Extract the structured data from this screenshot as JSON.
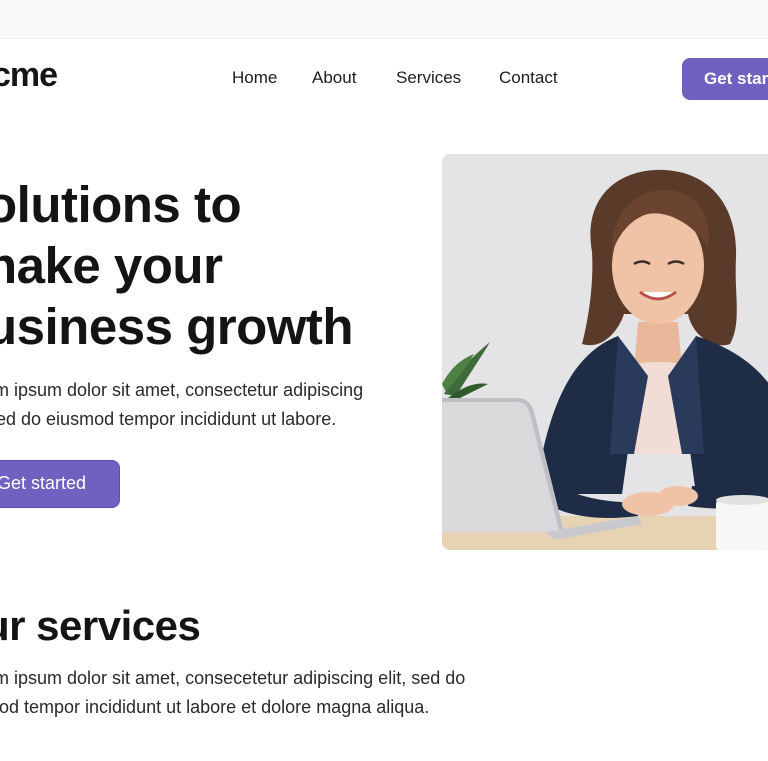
{
  "header": {
    "logo": "cme",
    "nav": [
      {
        "label": "Home"
      },
      {
        "label": "About"
      },
      {
        "label": "Services"
      },
      {
        "label": "Contact"
      }
    ],
    "cta_label": "Get started"
  },
  "hero": {
    "title_lines": [
      "olutions to",
      "nake your",
      "usiness growth"
    ],
    "description_lines": [
      "em ipsum dolor sit amet, consectetur adipiscing",
      "Sed do eiusmod tempor incididunt ut labore."
    ],
    "cta_label": "Get started"
  },
  "services": {
    "title": "ur services",
    "description_lines": [
      "em ipsum dolor sit amet, consecetetur adipiscing elit, sed do",
      "mod tempor incididunt ut labore et dolore magna aliqua."
    ]
  },
  "colors": {
    "accent": "#7160c0",
    "text": "#151515"
  }
}
